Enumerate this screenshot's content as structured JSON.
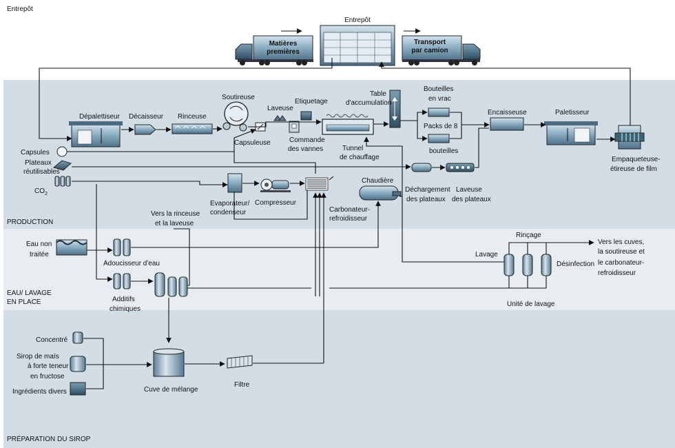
{
  "zones": {
    "warehouse": "Entrepôt",
    "production": "PRODUCTION",
    "water_line1": "EAU/ LAVAGE",
    "water_line2": "EN PLACE",
    "syrup": "PRÉPARATION DU SIROP"
  },
  "warehouse": {
    "building": "Entrepôt",
    "raw_line1": "Matières",
    "raw_line2": "premières",
    "transport_line1": "Transport",
    "transport_line2": "par camion"
  },
  "production": {
    "depalletizer": "Dépalettiseur",
    "decaser": "Décaisseur",
    "rinser": "Rinceuse",
    "filler": "Soutireuse",
    "capper": "Capsuleuse",
    "washer": "Laveuse",
    "labeling": "Etiquetage",
    "valve_ctrl_line1": "Commande",
    "valve_ctrl_line2": "des vannes",
    "accum_line1": "Table",
    "accum_line2": "d'accumulation",
    "tunnel_line1": "Tunnel",
    "tunnel_line2": "de chauffage",
    "bulk_line1": "Bouteilles",
    "bulk_line2": "en vrac",
    "packs_line1": "Packs de 8",
    "packs_line2": "bouteilles",
    "caser": "Encaisseuse",
    "palletizer": "Paletisseur",
    "wrapper_line1": "Empaqueteuse-",
    "wrapper_line2": "étireuse de film",
    "caps": "Capsules",
    "trays_line1": "Plateaux",
    "trays_line2": "réutilisables",
    "co2": "CO",
    "co2_sub": "2",
    "evaporator_line1": "Evaporateur/",
    "evaporator_line2": "condenseur",
    "compressor": "Compresseur",
    "boiler": "Chaudière",
    "carbonator_line1": "Carbonateur-",
    "carbonator_line2": "refroidisseur",
    "unload_line1": "Déchargement",
    "unload_line2": "des plateaux",
    "traywasher_line1": "Laveuse",
    "traywasher_line2": "des plateaux",
    "to_rinser_line1": "Vers la rinceuse",
    "to_rinser_line2": "et la laveuse"
  },
  "water": {
    "raw_line1": "Eau non",
    "raw_line2": "traitée",
    "softener": "Adoucisseur d'eau",
    "additives_line1": "Additifs",
    "additives_line2": "chimiques",
    "washing": "Lavage",
    "rinsing": "Rinçage",
    "disinfection": "Désinfection",
    "cip_unit": "Unité de lavage",
    "to_tanks_line1": "Vers les cuves,",
    "to_tanks_line2": "la soutireuse et",
    "to_tanks_line3": "le carbonateur-",
    "to_tanks_line4": "refroidisseur"
  },
  "syrup": {
    "concentrate": "Concentré",
    "hfcs_line1": "Sirop de maïs",
    "hfcs_line2": "à forte teneur",
    "hfcs_line3": "en fructose",
    "misc": "Ingrédients divers",
    "mix_tank": "Cuve de mélange",
    "filter": "Filtre"
  },
  "colors": {
    "band_light": "#e8edf2",
    "band_dark": "#d2dce5",
    "equipment": "#6f93ab",
    "equipment_dark": "#3d5f78",
    "equipment_light": "#c9d9e4"
  }
}
